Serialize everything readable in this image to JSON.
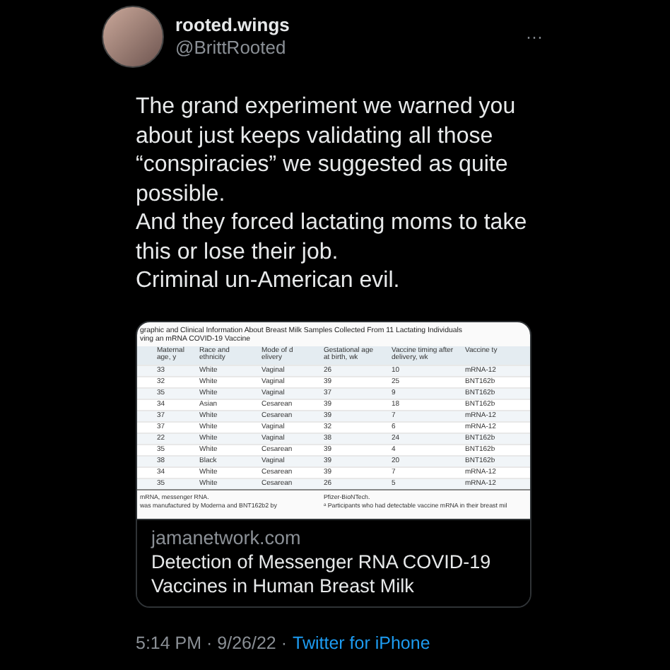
{
  "author": {
    "name": "rooted.wings",
    "handle": "@BrittRooted"
  },
  "more": "···",
  "tweet": [
    "The grand experiment we warned you about just keeps validating all those “conspiracies” we suggested as quite possible.",
    "And they forced lactating moms to take this or lose their job.",
    "Criminal un-American evil."
  ],
  "link_card": {
    "table_title": [
      "graphic and Clinical Information About Breast Milk Samples Collected From 11 Lactating Individuals",
      "ving an mRNA COVID-19 Vaccine"
    ],
    "columns": [
      "Maternal age, y",
      "Race and ethnicity",
      "Mode of d elivery",
      "Gestational age at birth, wk",
      "Vaccine timing after delivery, wk",
      "Vaccine ty"
    ],
    "rows": [
      [
        "33",
        "White",
        "Vaginal",
        "26",
        "10",
        "mRNA-12"
      ],
      [
        "32",
        "White",
        "Vaginal",
        "39",
        "25",
        "BNT162b"
      ],
      [
        "35",
        "White",
        "Vaginal",
        "37",
        "9",
        "BNT162b"
      ],
      [
        "34",
        "Asian",
        "Cesarean",
        "39",
        "18",
        "BNT162b"
      ],
      [
        "37",
        "White",
        "Cesarean",
        "39",
        "7",
        "mRNA-12"
      ],
      [
        "37",
        "White",
        "Vaginal",
        "32",
        "6",
        "mRNA-12"
      ],
      [
        "22",
        "White",
        "Vaginal",
        "38",
        "24",
        "BNT162b"
      ],
      [
        "35",
        "White",
        "Cesarean",
        "39",
        "4",
        "BNT162b"
      ],
      [
        "38",
        "Black",
        "Vaginal",
        "39",
        "20",
        "BNT162b"
      ],
      [
        "34",
        "White",
        "Cesarean",
        "39",
        "7",
        "mRNA-12"
      ],
      [
        "35",
        "White",
        "Cesarean",
        "26",
        "5",
        "mRNA-12"
      ]
    ],
    "footnotes": [
      [
        "mRNA, messenger RNA.",
        "Pfizer-BioNTech."
      ],
      [
        "was manufactured by Moderna and BNT162b2 by",
        "ᵃ Participants who had detectable vaccine mRNA in their breast mil"
      ]
    ],
    "domain": "jamanetwork.com",
    "title": "Detection of Messenger RNA COVID-19 Vaccines in Human Breast Milk"
  },
  "footer": {
    "time": "5:14 PM · 9/26/22 ·",
    "source": "Twitter for iPhone"
  }
}
